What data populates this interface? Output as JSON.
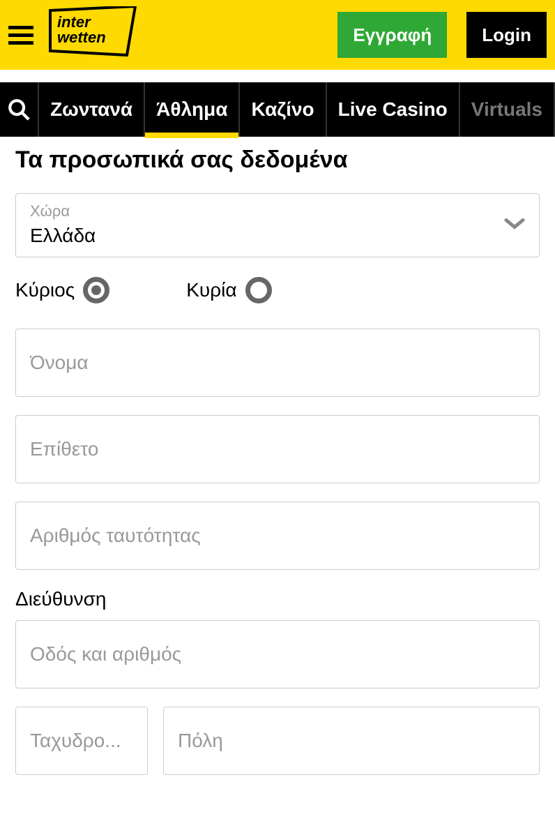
{
  "header": {
    "register_label": "Εγγραφή",
    "login_label": "Login",
    "logo_line1": "inter",
    "logo_line2": "wetten"
  },
  "nav": {
    "items": [
      {
        "label": "Ζωντανά",
        "active": false
      },
      {
        "label": "Άθλημα",
        "active": true
      },
      {
        "label": "Καζίνο",
        "active": false
      },
      {
        "label": "Live Casino",
        "active": false
      },
      {
        "label": "Virtuals",
        "active": false,
        "faded": true
      }
    ]
  },
  "form": {
    "title": "Τα προσωπικά σας δεδομένα",
    "country": {
      "label": "Χώρα",
      "value": "Ελλάδα"
    },
    "salutation": {
      "mr": "Κύριος",
      "mrs": "Κυρία",
      "selected": "mr"
    },
    "firstname_placeholder": "Όνομα",
    "lastname_placeholder": "Επίθετο",
    "idnumber_placeholder": "Αριθμός ταυτότητας",
    "address_label": "Διεύθυνση",
    "street_placeholder": "Οδός και αριθμός",
    "postal_placeholder": "Ταχυδρο...",
    "city_placeholder": "Πόλη"
  }
}
